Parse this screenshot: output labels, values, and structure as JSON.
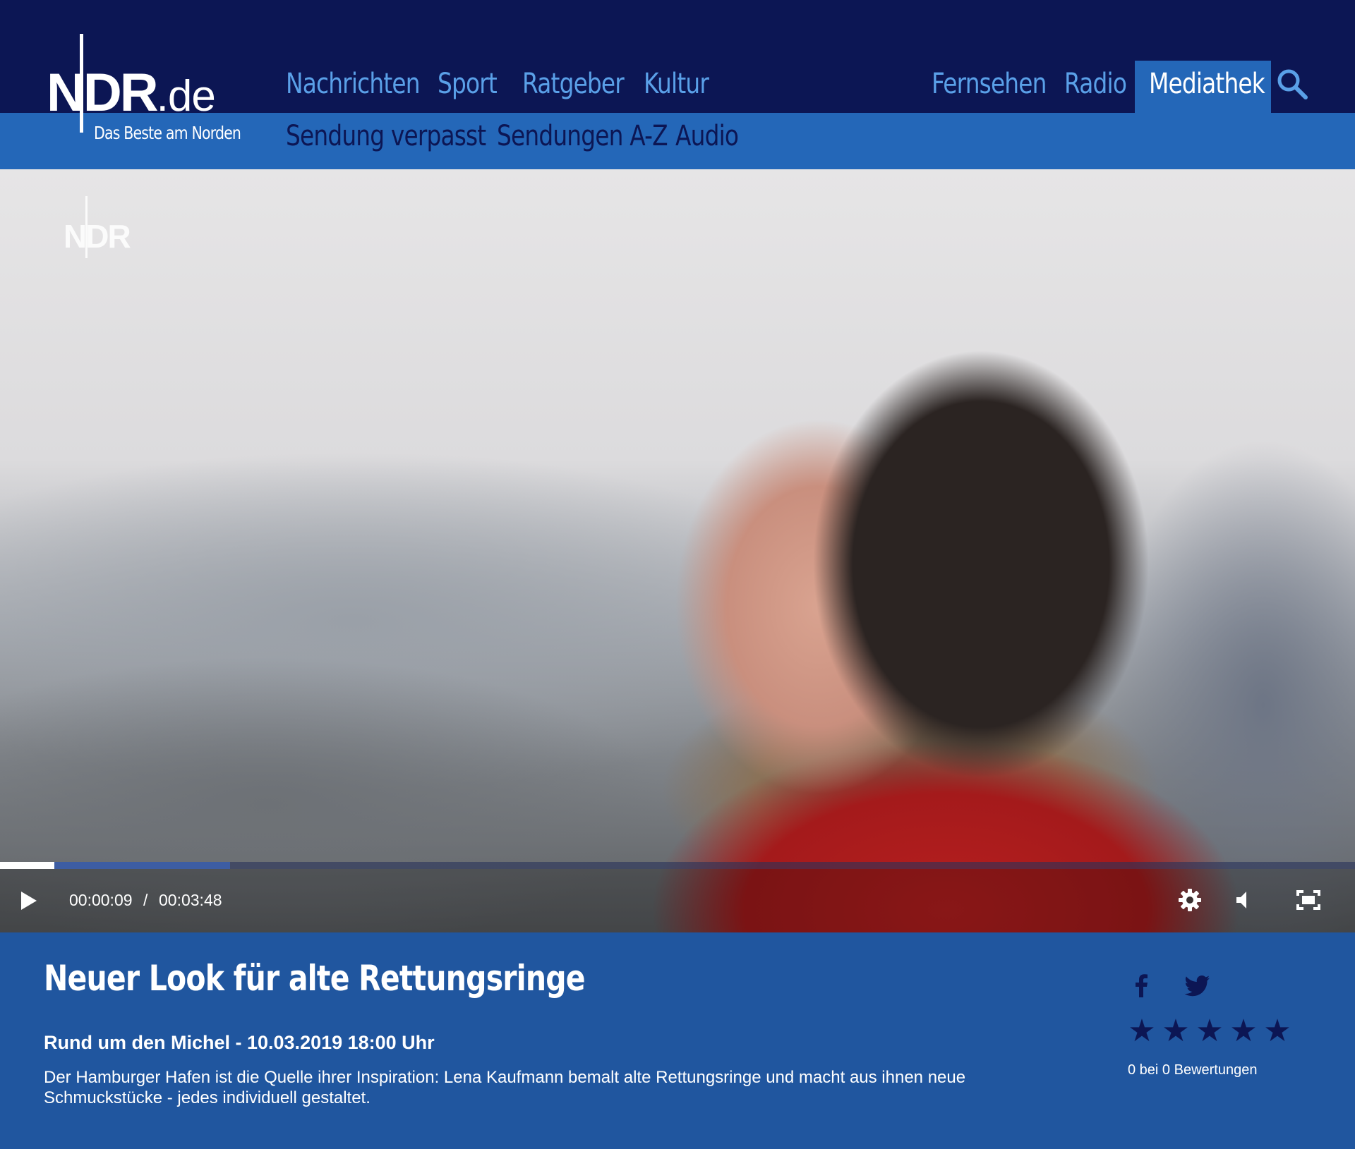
{
  "logo": {
    "brand": "NDR",
    "domain": ".de",
    "claim": "Das Beste am Norden"
  },
  "nav": {
    "main": [
      {
        "label": "Nachrichten"
      },
      {
        "label": "Sport"
      },
      {
        "label": "Ratgeber"
      },
      {
        "label": "Kultur"
      }
    ],
    "right": [
      {
        "label": "Fernsehen"
      },
      {
        "label": "Radio"
      }
    ],
    "active": "Mediathek",
    "sub": [
      {
        "label": "Sendung verpasst"
      },
      {
        "label": "Sendungen A-Z"
      },
      {
        "label": "Audio"
      }
    ]
  },
  "player": {
    "watermark": "NDR",
    "time_current": "00:00:09",
    "time_separator": "/",
    "time_total": "00:03:48",
    "progress_played_fraction": 0.04,
    "progress_buffered_fraction": 0.17,
    "icons": [
      "play-icon",
      "gear-icon",
      "volume-icon",
      "fullscreen-icon"
    ]
  },
  "article": {
    "title": "Neuer Look für alte Rettungsringe",
    "subtitle": "Rund um den Michel - 10.03.2019 18:00 Uhr",
    "description": "Der Hamburger Hafen ist die Quelle ihrer Inspiration: Lena Kaufmann bemalt alte Rettungsringe und macht aus ihnen neue Schmuckstücke - jedes individuell gestaltet.",
    "rating_text": "0 bei 0 Bewertungen",
    "stars_total": 5,
    "stars_filled": 0
  },
  "colors": {
    "header_bg": "#0c1654",
    "subbar_bg": "#2467b8",
    "nav_link": "#5aa0e8",
    "info_bg": "#20569f",
    "star": "#0c1654"
  }
}
